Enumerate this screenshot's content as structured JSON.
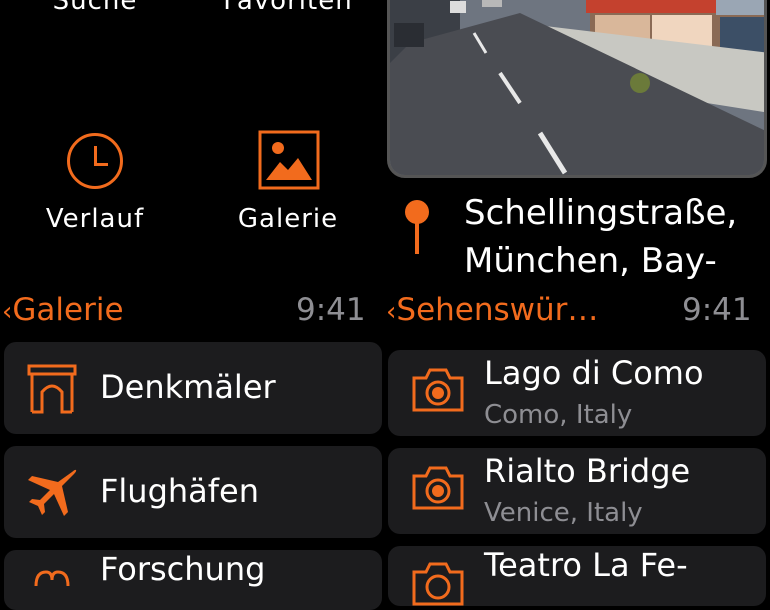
{
  "left_screen": {
    "grid": {
      "items": [
        {
          "label": "Suche"
        },
        {
          "label": "Favoriten"
        },
        {
          "label": "Verlauf",
          "icon": "clock-icon"
        },
        {
          "label": "Galerie",
          "icon": "gallery-icon"
        }
      ]
    },
    "status": {
      "back_label": "Galerie",
      "time": "9:41"
    },
    "list": [
      {
        "label": "Denkmäler",
        "icon": "monument-icon"
      },
      {
        "label": "Flughäfen",
        "icon": "airplane-icon"
      },
      {
        "label": "Forschung",
        "icon": "research-icon"
      }
    ]
  },
  "right_screen": {
    "location": {
      "line1": "Schellingstraße,",
      "line2": "München, Bay-",
      "icon": "location-pin-icon"
    },
    "status": {
      "back_label": "Sehenswür…",
      "time": "9:41"
    },
    "list": [
      {
        "title": "Lago di Como",
        "subtitle": "Como, Italy",
        "icon": "camera-icon"
      },
      {
        "title": "Rialto Bridge",
        "subtitle": "Venice, Italy",
        "icon": "camera-icon"
      },
      {
        "title": "Teatro La Fe-",
        "subtitle": "",
        "icon": "camera-icon"
      }
    ]
  },
  "colors": {
    "accent": "#f26b1d",
    "background": "#000000",
    "cell": "#1c1c1e"
  }
}
